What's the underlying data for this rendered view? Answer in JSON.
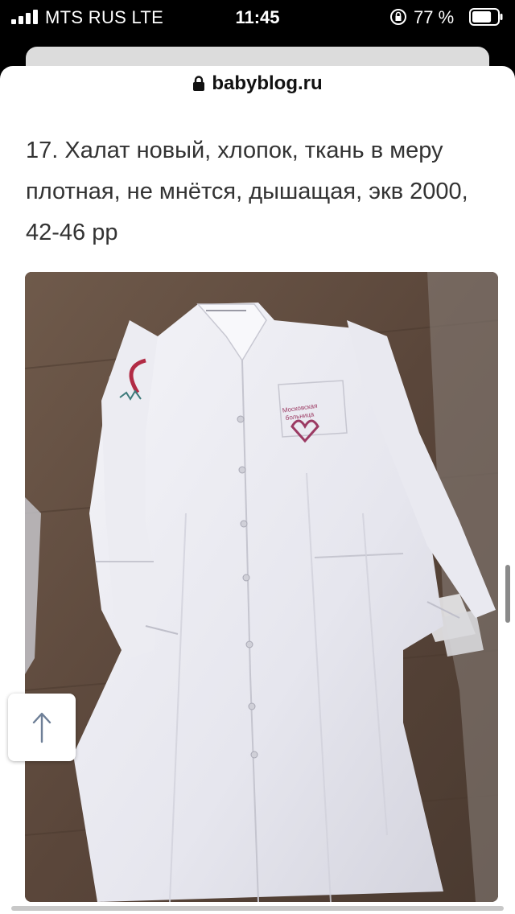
{
  "status_bar": {
    "carrier": "MTS RUS  LTE",
    "time": "11:45",
    "battery_percent": "77 %",
    "battery_level": 0.77
  },
  "browser": {
    "domain": "babyblog.ru",
    "lock_icon": "lock-icon"
  },
  "post": {
    "caption": "17. Халат новый, хлопок, ткань в меру плотная, не мнётся, дышащая, экв 2000, 42-46 рр",
    "photo": {
      "description_icon": "white-medical-coat-photo",
      "chest_logo_text": "Московская больница"
    }
  },
  "scroll_top_button": {
    "icon": "arrow-up-icon"
  },
  "colors": {
    "status_bar_bg": "#000000",
    "page_bg": "#ffffff",
    "caption_text": "#333333",
    "logo_accent": "#9b3a63"
  }
}
